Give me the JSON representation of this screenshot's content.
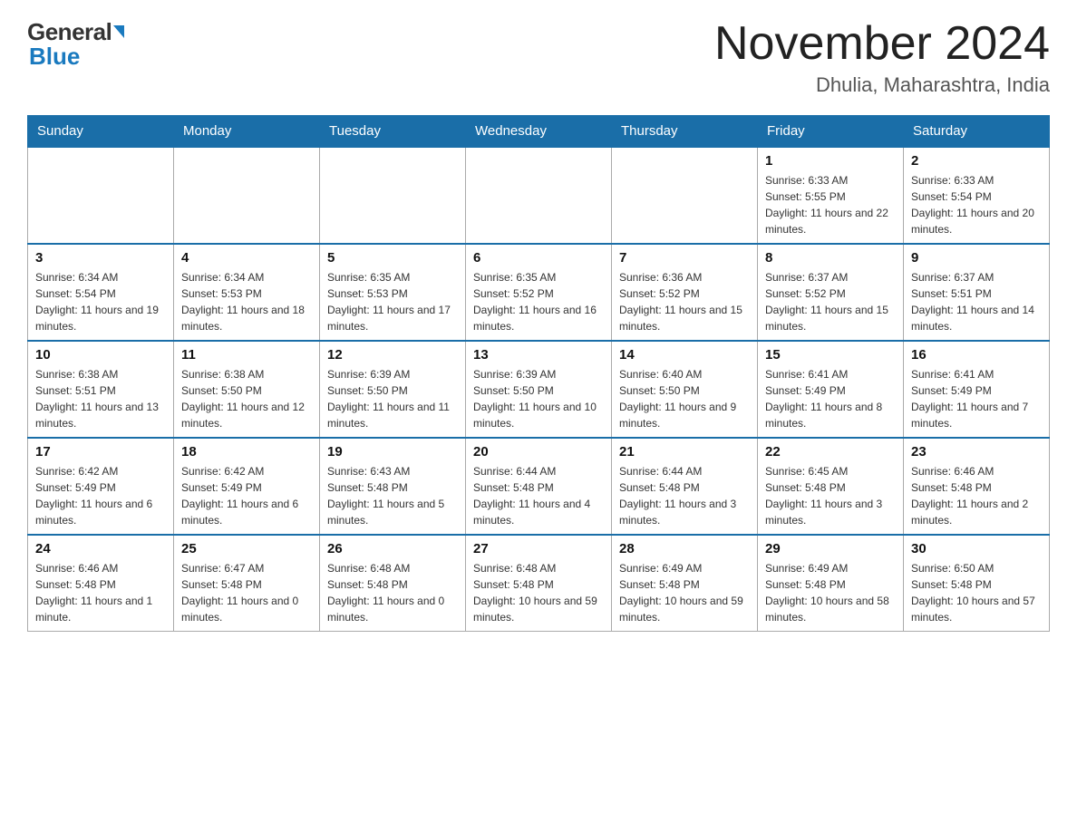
{
  "header": {
    "logo_general": "General",
    "logo_blue": "Blue",
    "month_year": "November 2024",
    "location": "Dhulia, Maharashtra, India"
  },
  "weekdays": [
    "Sunday",
    "Monday",
    "Tuesday",
    "Wednesday",
    "Thursday",
    "Friday",
    "Saturday"
  ],
  "weeks": [
    [
      {
        "day": "",
        "sunrise": "",
        "sunset": "",
        "daylight": ""
      },
      {
        "day": "",
        "sunrise": "",
        "sunset": "",
        "daylight": ""
      },
      {
        "day": "",
        "sunrise": "",
        "sunset": "",
        "daylight": ""
      },
      {
        "day": "",
        "sunrise": "",
        "sunset": "",
        "daylight": ""
      },
      {
        "day": "",
        "sunrise": "",
        "sunset": "",
        "daylight": ""
      },
      {
        "day": "1",
        "sunrise": "Sunrise: 6:33 AM",
        "sunset": "Sunset: 5:55 PM",
        "daylight": "Daylight: 11 hours and 22 minutes."
      },
      {
        "day": "2",
        "sunrise": "Sunrise: 6:33 AM",
        "sunset": "Sunset: 5:54 PM",
        "daylight": "Daylight: 11 hours and 20 minutes."
      }
    ],
    [
      {
        "day": "3",
        "sunrise": "Sunrise: 6:34 AM",
        "sunset": "Sunset: 5:54 PM",
        "daylight": "Daylight: 11 hours and 19 minutes."
      },
      {
        "day": "4",
        "sunrise": "Sunrise: 6:34 AM",
        "sunset": "Sunset: 5:53 PM",
        "daylight": "Daylight: 11 hours and 18 minutes."
      },
      {
        "day": "5",
        "sunrise": "Sunrise: 6:35 AM",
        "sunset": "Sunset: 5:53 PM",
        "daylight": "Daylight: 11 hours and 17 minutes."
      },
      {
        "day": "6",
        "sunrise": "Sunrise: 6:35 AM",
        "sunset": "Sunset: 5:52 PM",
        "daylight": "Daylight: 11 hours and 16 minutes."
      },
      {
        "day": "7",
        "sunrise": "Sunrise: 6:36 AM",
        "sunset": "Sunset: 5:52 PM",
        "daylight": "Daylight: 11 hours and 15 minutes."
      },
      {
        "day": "8",
        "sunrise": "Sunrise: 6:37 AM",
        "sunset": "Sunset: 5:52 PM",
        "daylight": "Daylight: 11 hours and 15 minutes."
      },
      {
        "day": "9",
        "sunrise": "Sunrise: 6:37 AM",
        "sunset": "Sunset: 5:51 PM",
        "daylight": "Daylight: 11 hours and 14 minutes."
      }
    ],
    [
      {
        "day": "10",
        "sunrise": "Sunrise: 6:38 AM",
        "sunset": "Sunset: 5:51 PM",
        "daylight": "Daylight: 11 hours and 13 minutes."
      },
      {
        "day": "11",
        "sunrise": "Sunrise: 6:38 AM",
        "sunset": "Sunset: 5:50 PM",
        "daylight": "Daylight: 11 hours and 12 minutes."
      },
      {
        "day": "12",
        "sunrise": "Sunrise: 6:39 AM",
        "sunset": "Sunset: 5:50 PM",
        "daylight": "Daylight: 11 hours and 11 minutes."
      },
      {
        "day": "13",
        "sunrise": "Sunrise: 6:39 AM",
        "sunset": "Sunset: 5:50 PM",
        "daylight": "Daylight: 11 hours and 10 minutes."
      },
      {
        "day": "14",
        "sunrise": "Sunrise: 6:40 AM",
        "sunset": "Sunset: 5:50 PM",
        "daylight": "Daylight: 11 hours and 9 minutes."
      },
      {
        "day": "15",
        "sunrise": "Sunrise: 6:41 AM",
        "sunset": "Sunset: 5:49 PM",
        "daylight": "Daylight: 11 hours and 8 minutes."
      },
      {
        "day": "16",
        "sunrise": "Sunrise: 6:41 AM",
        "sunset": "Sunset: 5:49 PM",
        "daylight": "Daylight: 11 hours and 7 minutes."
      }
    ],
    [
      {
        "day": "17",
        "sunrise": "Sunrise: 6:42 AM",
        "sunset": "Sunset: 5:49 PM",
        "daylight": "Daylight: 11 hours and 6 minutes."
      },
      {
        "day": "18",
        "sunrise": "Sunrise: 6:42 AM",
        "sunset": "Sunset: 5:49 PM",
        "daylight": "Daylight: 11 hours and 6 minutes."
      },
      {
        "day": "19",
        "sunrise": "Sunrise: 6:43 AM",
        "sunset": "Sunset: 5:48 PM",
        "daylight": "Daylight: 11 hours and 5 minutes."
      },
      {
        "day": "20",
        "sunrise": "Sunrise: 6:44 AM",
        "sunset": "Sunset: 5:48 PM",
        "daylight": "Daylight: 11 hours and 4 minutes."
      },
      {
        "day": "21",
        "sunrise": "Sunrise: 6:44 AM",
        "sunset": "Sunset: 5:48 PM",
        "daylight": "Daylight: 11 hours and 3 minutes."
      },
      {
        "day": "22",
        "sunrise": "Sunrise: 6:45 AM",
        "sunset": "Sunset: 5:48 PM",
        "daylight": "Daylight: 11 hours and 3 minutes."
      },
      {
        "day": "23",
        "sunrise": "Sunrise: 6:46 AM",
        "sunset": "Sunset: 5:48 PM",
        "daylight": "Daylight: 11 hours and 2 minutes."
      }
    ],
    [
      {
        "day": "24",
        "sunrise": "Sunrise: 6:46 AM",
        "sunset": "Sunset: 5:48 PM",
        "daylight": "Daylight: 11 hours and 1 minute."
      },
      {
        "day": "25",
        "sunrise": "Sunrise: 6:47 AM",
        "sunset": "Sunset: 5:48 PM",
        "daylight": "Daylight: 11 hours and 0 minutes."
      },
      {
        "day": "26",
        "sunrise": "Sunrise: 6:48 AM",
        "sunset": "Sunset: 5:48 PM",
        "daylight": "Daylight: 11 hours and 0 minutes."
      },
      {
        "day": "27",
        "sunrise": "Sunrise: 6:48 AM",
        "sunset": "Sunset: 5:48 PM",
        "daylight": "Daylight: 10 hours and 59 minutes."
      },
      {
        "day": "28",
        "sunrise": "Sunrise: 6:49 AM",
        "sunset": "Sunset: 5:48 PM",
        "daylight": "Daylight: 10 hours and 59 minutes."
      },
      {
        "day": "29",
        "sunrise": "Sunrise: 6:49 AM",
        "sunset": "Sunset: 5:48 PM",
        "daylight": "Daylight: 10 hours and 58 minutes."
      },
      {
        "day": "30",
        "sunrise": "Sunrise: 6:50 AM",
        "sunset": "Sunset: 5:48 PM",
        "daylight": "Daylight: 10 hours and 57 minutes."
      }
    ]
  ]
}
